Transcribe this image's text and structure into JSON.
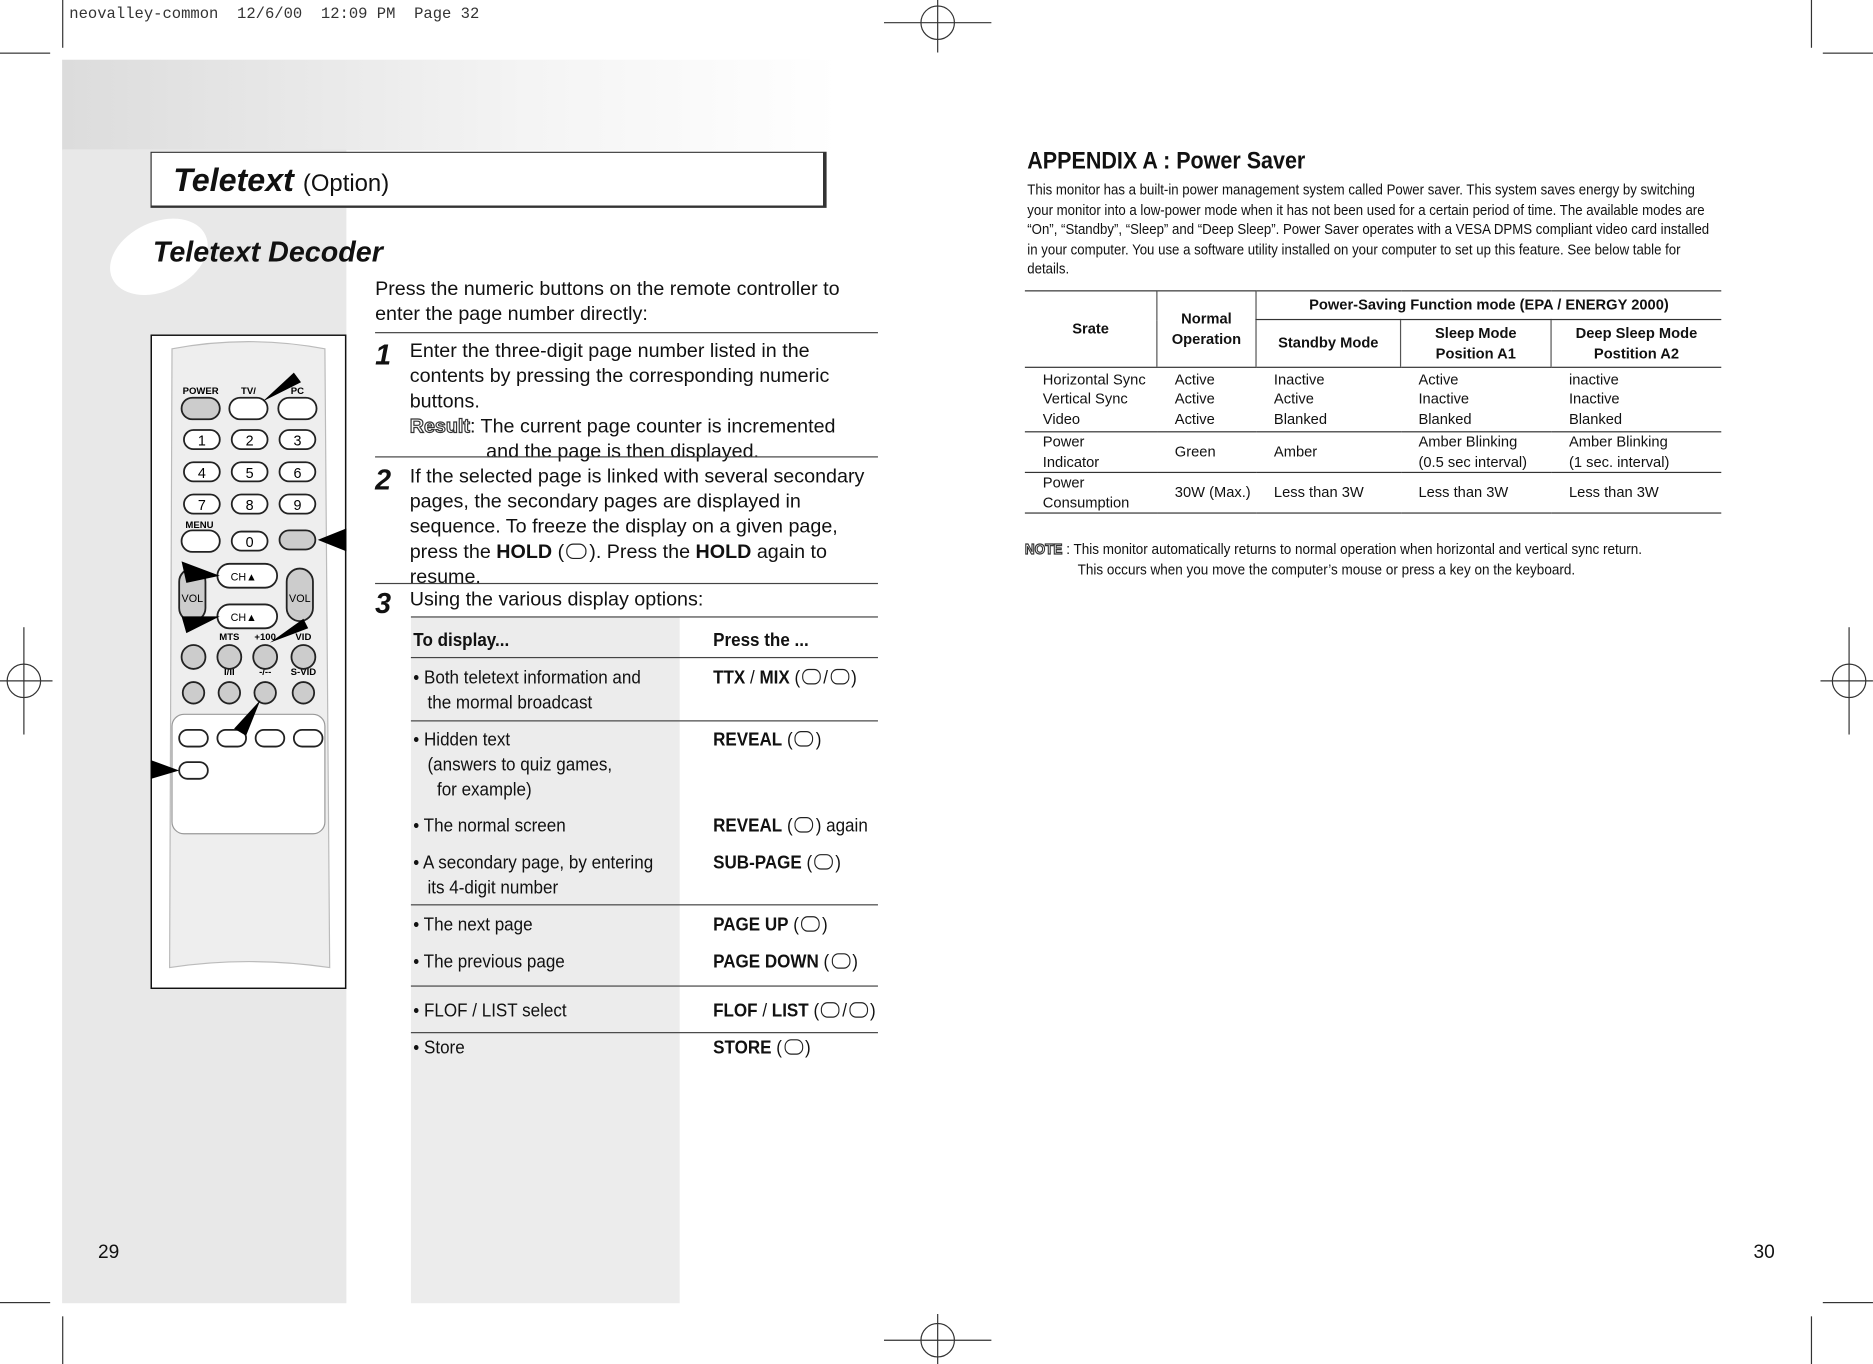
{
  "slug": "neovalley-common  12/6/00  12:09 PM  Page 32",
  "left": {
    "title": "Teletext",
    "title_suffix": "(Option)",
    "subtitle": "Teletext Decoder",
    "intro": "Press the numeric buttons on the remote controller to enter the page number directly:",
    "steps": [
      {
        "num": "1",
        "text": "Enter the three-digit page number listed in the contents by pressing the corresponding numeric buttons.",
        "result_label": "Result",
        "result_text": ": The current page counter is incremented",
        "result_text2": "and the page is then displayed."
      },
      {
        "num": "2",
        "text_a": "If the selected page is linked with several secondary pages, the secondary pages are displayed in sequence. To freeze the display on a given page, press the ",
        "hold": "HOLD",
        "text_b": "). Press the ",
        "hold2": "HOLD",
        "text_c": " again to resume."
      },
      {
        "num": "3",
        "text": "Using the various display options:"
      }
    ],
    "table": {
      "headers": [
        "To display...",
        "Press the ..."
      ],
      "rows": [
        {
          "display": "• Both teletext information and\n   the mormal broadcast",
          "key": "TTX",
          "sep": " / ",
          "key2": "MIX",
          "suffix": ""
        },
        {
          "display": "• Hidden text\n   (answers to quiz games,\n     for example)",
          "key": "REVEAL",
          "suffix": ""
        },
        {
          "display": "• The normal screen",
          "key": "REVEAL",
          "suffix": " again"
        },
        {
          "display": "• A secondary page, by entering\n   its 4-digit number",
          "key": "SUB-PAGE",
          "suffix": ""
        },
        {
          "display": "• The next page",
          "key": "PAGE UP",
          "suffix": ""
        },
        {
          "display": "• The previous page",
          "key": "PAGE DOWN",
          "suffix": ""
        },
        {
          "display": "• FLOF / LIST select",
          "key": "FLOF",
          "sep": " / ",
          "key2": "LIST",
          "suffix": ""
        },
        {
          "display": "• Store",
          "key": "STORE",
          "suffix": ""
        }
      ]
    },
    "remote": {
      "labels": {
        "power": "POWER",
        "tv": "TV/",
        "pc": "PC",
        "menu": "MENU",
        "ch": "CH▲",
        "vol": "VOL",
        "mts": "MTS",
        "p100": "+100",
        "vid": "VID",
        "i_ii": "I/II",
        "dash": "-/--",
        "svid": "S-VID"
      },
      "digits": [
        "1",
        "2",
        "3",
        "4",
        "5",
        "6",
        "7",
        "8",
        "9",
        "0"
      ]
    },
    "page_number": "29"
  },
  "right": {
    "title": "APPENDIX A : Power Saver",
    "paragraph": "This monitor has a built-in power management system called Power saver. This system saves energy by switching your monitor into a low-power mode when it has not been used for a certain period of time. The available modes are “On”, “Standby”, “Sleep” and “Deep Sleep”. Power Saver operates with a VESA DPMS compliant video card installed in your computer. You use a software utility installed on your computer to set up this feature. See below table for details.",
    "table": {
      "h_state": "Srate",
      "h_normal": "Normal\nOperation",
      "h_group": "Power-Saving Function mode (EPA / ENERGY 2000)",
      "h_standby": "Standby Mode",
      "h_sleep": "Sleep Mode\nPosition A1",
      "h_deep": "Deep Sleep Mode\nPostition A2",
      "rows": [
        [
          "Horizontal Sync\nVertical Sync\nVideo",
          "Active\nActive\nActive",
          "Inactive\nActive\nBlanked",
          "Active\nInactive\nBlanked",
          "inactive\nInactive\nBlanked"
        ],
        [
          "Power\nIndicator",
          "Green",
          "Amber",
          "Amber Blinking\n(0.5 sec interval)",
          "Amber Blinking\n(1 sec. interval)"
        ],
        [
          "Power\nConsumption",
          "30W (Max.)",
          "Less than 3W",
          "Less than 3W",
          "Less than 3W"
        ]
      ]
    },
    "note_label": "NOTE",
    "note_line1": ": This monitor automatically returns to normal operation when horizontal and vertical sync return.",
    "note_line2": "This occurs when you move the computer’s mouse or press a key on the keyboard.",
    "page_number": "30"
  }
}
